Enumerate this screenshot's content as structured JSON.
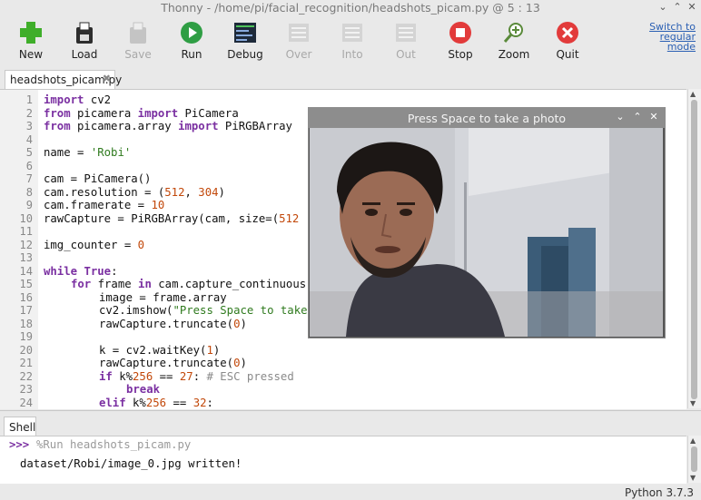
{
  "window": {
    "title": "Thonny  -  /home/pi/facial_recognition/headshots_picam.py  @  5 : 13"
  },
  "toolbar": {
    "buttons": [
      {
        "label": "New",
        "icon": "new-file-icon",
        "enabled": true
      },
      {
        "label": "Load",
        "icon": "load-icon",
        "enabled": true
      },
      {
        "label": "Save",
        "icon": "save-icon",
        "enabled": false
      },
      {
        "label": "Run",
        "icon": "run-icon",
        "enabled": true
      },
      {
        "label": "Debug",
        "icon": "debug-icon",
        "enabled": true
      },
      {
        "label": "Over",
        "icon": "step-over-icon",
        "enabled": false
      },
      {
        "label": "Into",
        "icon": "step-into-icon",
        "enabled": false
      },
      {
        "label": "Out",
        "icon": "step-out-icon",
        "enabled": false
      },
      {
        "label": "Stop",
        "icon": "stop-icon",
        "enabled": true
      },
      {
        "label": "Zoom",
        "icon": "zoom-icon",
        "enabled": true
      },
      {
        "label": "Quit",
        "icon": "quit-icon",
        "enabled": true
      }
    ],
    "switch_mode": "Switch to regular mode"
  },
  "editor": {
    "tab_label": "headshots_picam.py",
    "lines": [
      "1",
      "2",
      "3",
      "4",
      "5",
      "6",
      "7",
      "8",
      "9",
      "10",
      "11",
      "12",
      "13",
      "14",
      "15",
      "16",
      "17",
      "18",
      "19",
      "20",
      "21",
      "22",
      "23",
      "24"
    ],
    "code": {
      "l1_kw": "import",
      "l1_rest": " cv2",
      "l2_kw": "from",
      "l2_mid": " picamera ",
      "l2_kw2": "import",
      "l2_rest": " PiCamera",
      "l3_kw": "from",
      "l3_mid": " picamera.array ",
      "l3_kw2": "import",
      "l3_rest": " PiRGBArray",
      "l5_a": "name = ",
      "l5_s": "'Robi'",
      "l7": "cam = PiCamera()",
      "l8_a": "cam.resolution = (",
      "l8_n1": "512",
      "l8_b": ", ",
      "l8_n2": "304",
      "l8_c": ")",
      "l9_a": "cam.framerate = ",
      "l9_n": "10",
      "l10_a": "rawCapture = PiRGBArray(cam, size=(",
      "l10_n": "512",
      "l12_a": "img_counter = ",
      "l12_n": "0",
      "l14_kw": "while",
      "l14_mid": " ",
      "l14_kw2": "True",
      "l14_rest": ":",
      "l15_kw": "for",
      "l15_mid": " frame ",
      "l15_kw2": "in",
      "l15_rest": " cam.capture_continuous",
      "l16": "image = frame.array",
      "l17_a": "cv2.imshow(",
      "l17_s": "\"Press Space to take",
      "l18_a": "rawCapture.truncate(",
      "l18_n": "0",
      "l18_b": ")",
      "l20_a": "k = cv2.waitKey(",
      "l20_n": "1",
      "l20_b": ")",
      "l21_a": "rawCapture.truncate(",
      "l21_n": "0",
      "l21_b": ")",
      "l22_kw": "if",
      "l22_a": " k%",
      "l22_n1": "256",
      "l22_b": " == ",
      "l22_n2": "27",
      "l22_c": ": ",
      "l22_cm": "# ESC pressed",
      "l23_kw": "break",
      "l24_kw": "elif",
      "l24_a": " k%",
      "l24_n1": "256",
      "l24_b": " == ",
      "l24_n2": "32",
      "l24_c": ":"
    }
  },
  "camera_window": {
    "title": "Press Space to take a photo"
  },
  "shell": {
    "tab_label": "Shell",
    "prompt": ">>>",
    "command": "%Run headshots_picam.py",
    "output": "dataset/Robi/image_0.jpg written!"
  },
  "status": {
    "python_version": "Python 3.7.3"
  }
}
